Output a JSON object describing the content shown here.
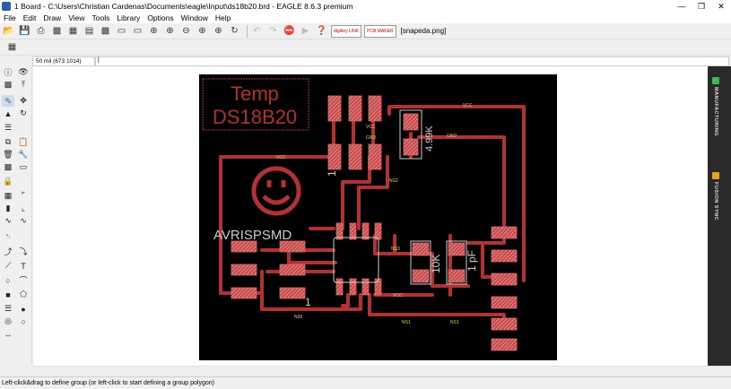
{
  "window": {
    "title": "1 Board - C:\\Users\\Christian Cardenas\\Documents\\eagle\\Input\\ds18b20.brd - EAGLE 8.6.3 premium"
  },
  "menu": [
    "File",
    "Edit",
    "Draw",
    "View",
    "Tools",
    "Library",
    "Options",
    "Window",
    "Help"
  ],
  "toolbar": {
    "badge1": "digikey LINK",
    "badge2": "PCB MAKER",
    "file": "[snapeda.png]"
  },
  "command": {
    "coordinate": "50 mil (673 1014)",
    "text": "|"
  },
  "right_panel": {
    "tab1": "MANUFACTURING",
    "tab2": "FUSION SYNC"
  },
  "board": {
    "title_line1": "Temp",
    "title_line2": "DS18B20",
    "silk_label": "AVRISPSMD",
    "r1": "4.99K",
    "r2": "10K",
    "c1": "1 pF",
    "pin1a": "1",
    "pin1b": "1",
    "nets": {
      "vcc": "VCC",
      "gnd": "GND",
      "ns1": "NS1",
      "ns2": "NS2",
      "ns3": "NS3",
      "n39": "N39"
    }
  },
  "status": "Left-click&drag to define group (or left-click to start defining a group polygon)",
  "colors": {
    "board": "#000000",
    "trace": "#b03232",
    "pad": "#c84a4a",
    "silk": "#cccccc"
  }
}
